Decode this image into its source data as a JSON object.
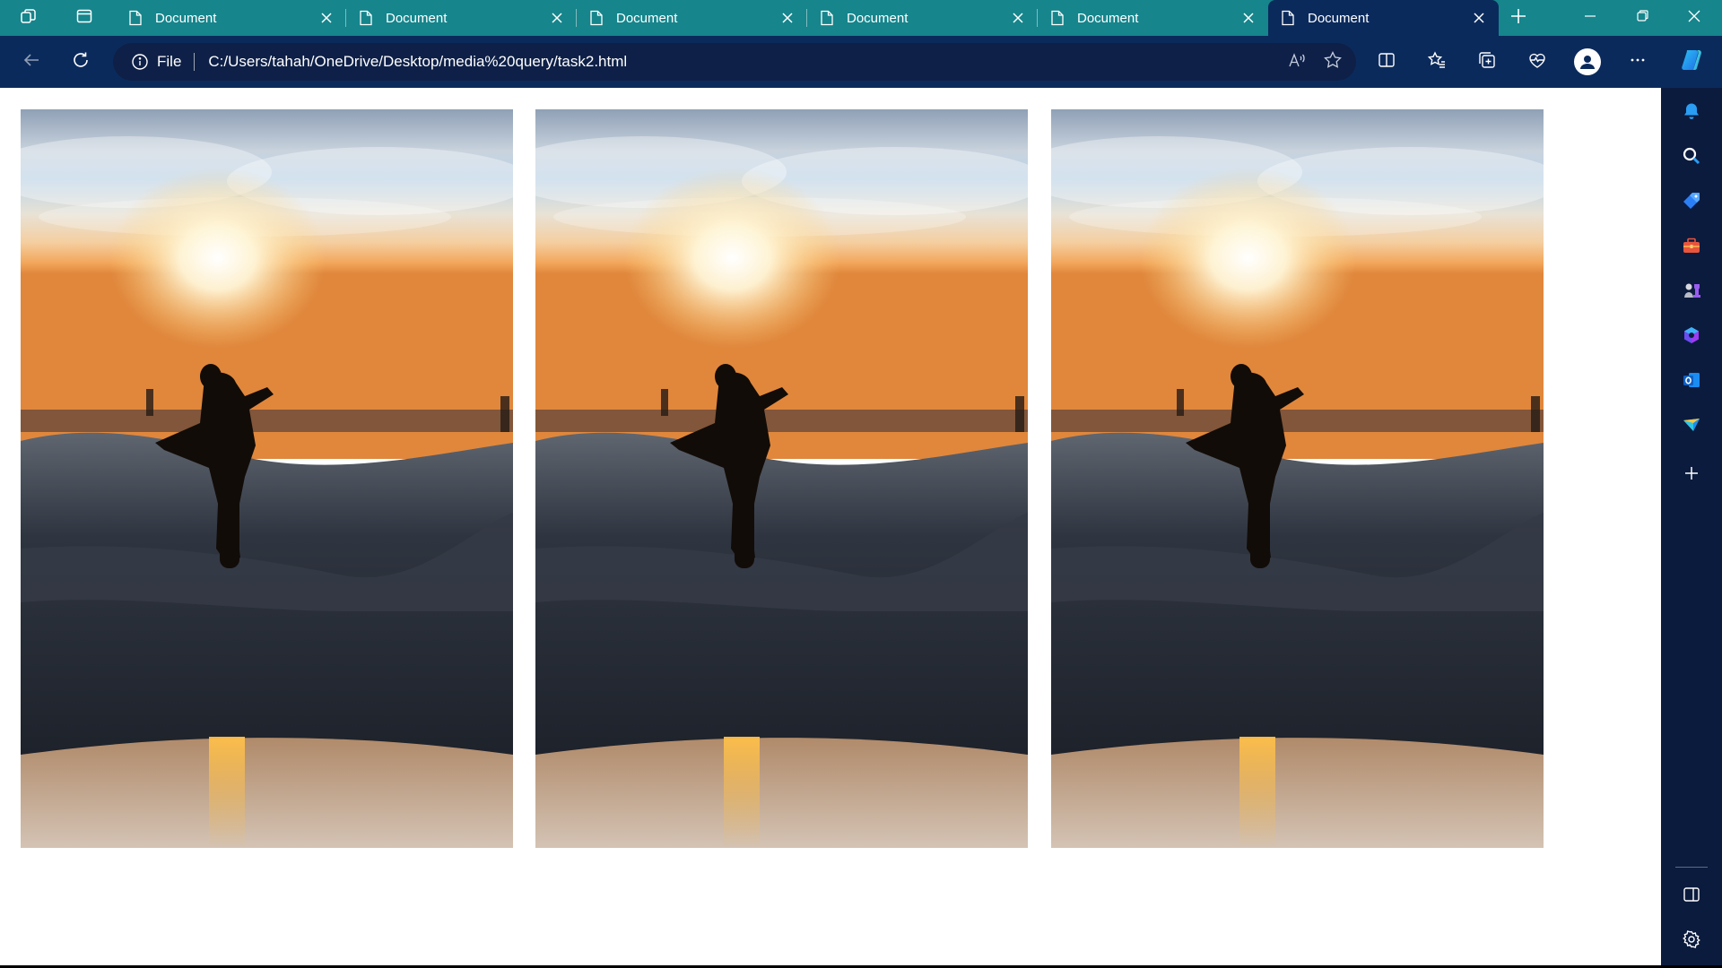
{
  "browser": {
    "tabs": [
      {
        "title": "Document",
        "active": false
      },
      {
        "title": "Document",
        "active": false
      },
      {
        "title": "Document",
        "active": false
      },
      {
        "title": "Document",
        "active": false
      },
      {
        "title": "Document",
        "active": false
      },
      {
        "title": "Document",
        "active": true
      }
    ],
    "address_bar": {
      "scheme_label": "File",
      "url": "C:/Users/tahah/OneDrive/Desktop/media%20query/task2.html"
    }
  },
  "page": {
    "images": [
      {
        "description": "skateboarder-silhouette-sunset-skatepark"
      },
      {
        "description": "skateboarder-silhouette-sunset-skatepark"
      },
      {
        "description": "skateboarder-silhouette-sunset-skatepark"
      }
    ]
  },
  "colors": {
    "tab_strip": "#16858c",
    "toolbar": "#0b2a5c",
    "sidebar": "#0b1b3e",
    "page_background": "#ffffff"
  }
}
